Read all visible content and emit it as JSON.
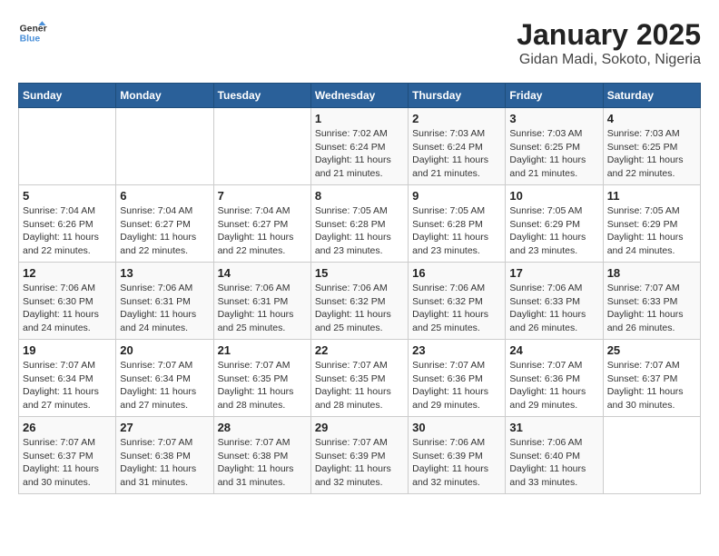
{
  "header": {
    "logo_line1": "General",
    "logo_line2": "Blue",
    "title": "January 2025",
    "subtitle": "Gidan Madi, Sokoto, Nigeria"
  },
  "weekdays": [
    "Sunday",
    "Monday",
    "Tuesday",
    "Wednesday",
    "Thursday",
    "Friday",
    "Saturday"
  ],
  "weeks": [
    [
      {
        "day": "",
        "info": ""
      },
      {
        "day": "",
        "info": ""
      },
      {
        "day": "",
        "info": ""
      },
      {
        "day": "1",
        "info": "Sunrise: 7:02 AM\nSunset: 6:24 PM\nDaylight: 11 hours and 21 minutes."
      },
      {
        "day": "2",
        "info": "Sunrise: 7:03 AM\nSunset: 6:24 PM\nDaylight: 11 hours and 21 minutes."
      },
      {
        "day": "3",
        "info": "Sunrise: 7:03 AM\nSunset: 6:25 PM\nDaylight: 11 hours and 21 minutes."
      },
      {
        "day": "4",
        "info": "Sunrise: 7:03 AM\nSunset: 6:25 PM\nDaylight: 11 hours and 22 minutes."
      }
    ],
    [
      {
        "day": "5",
        "info": "Sunrise: 7:04 AM\nSunset: 6:26 PM\nDaylight: 11 hours and 22 minutes."
      },
      {
        "day": "6",
        "info": "Sunrise: 7:04 AM\nSunset: 6:27 PM\nDaylight: 11 hours and 22 minutes."
      },
      {
        "day": "7",
        "info": "Sunrise: 7:04 AM\nSunset: 6:27 PM\nDaylight: 11 hours and 22 minutes."
      },
      {
        "day": "8",
        "info": "Sunrise: 7:05 AM\nSunset: 6:28 PM\nDaylight: 11 hours and 23 minutes."
      },
      {
        "day": "9",
        "info": "Sunrise: 7:05 AM\nSunset: 6:28 PM\nDaylight: 11 hours and 23 minutes."
      },
      {
        "day": "10",
        "info": "Sunrise: 7:05 AM\nSunset: 6:29 PM\nDaylight: 11 hours and 23 minutes."
      },
      {
        "day": "11",
        "info": "Sunrise: 7:05 AM\nSunset: 6:29 PM\nDaylight: 11 hours and 24 minutes."
      }
    ],
    [
      {
        "day": "12",
        "info": "Sunrise: 7:06 AM\nSunset: 6:30 PM\nDaylight: 11 hours and 24 minutes."
      },
      {
        "day": "13",
        "info": "Sunrise: 7:06 AM\nSunset: 6:31 PM\nDaylight: 11 hours and 24 minutes."
      },
      {
        "day": "14",
        "info": "Sunrise: 7:06 AM\nSunset: 6:31 PM\nDaylight: 11 hours and 25 minutes."
      },
      {
        "day": "15",
        "info": "Sunrise: 7:06 AM\nSunset: 6:32 PM\nDaylight: 11 hours and 25 minutes."
      },
      {
        "day": "16",
        "info": "Sunrise: 7:06 AM\nSunset: 6:32 PM\nDaylight: 11 hours and 25 minutes."
      },
      {
        "day": "17",
        "info": "Sunrise: 7:06 AM\nSunset: 6:33 PM\nDaylight: 11 hours and 26 minutes."
      },
      {
        "day": "18",
        "info": "Sunrise: 7:07 AM\nSunset: 6:33 PM\nDaylight: 11 hours and 26 minutes."
      }
    ],
    [
      {
        "day": "19",
        "info": "Sunrise: 7:07 AM\nSunset: 6:34 PM\nDaylight: 11 hours and 27 minutes."
      },
      {
        "day": "20",
        "info": "Sunrise: 7:07 AM\nSunset: 6:34 PM\nDaylight: 11 hours and 27 minutes."
      },
      {
        "day": "21",
        "info": "Sunrise: 7:07 AM\nSunset: 6:35 PM\nDaylight: 11 hours and 28 minutes."
      },
      {
        "day": "22",
        "info": "Sunrise: 7:07 AM\nSunset: 6:35 PM\nDaylight: 11 hours and 28 minutes."
      },
      {
        "day": "23",
        "info": "Sunrise: 7:07 AM\nSunset: 6:36 PM\nDaylight: 11 hours and 29 minutes."
      },
      {
        "day": "24",
        "info": "Sunrise: 7:07 AM\nSunset: 6:36 PM\nDaylight: 11 hours and 29 minutes."
      },
      {
        "day": "25",
        "info": "Sunrise: 7:07 AM\nSunset: 6:37 PM\nDaylight: 11 hours and 30 minutes."
      }
    ],
    [
      {
        "day": "26",
        "info": "Sunrise: 7:07 AM\nSunset: 6:37 PM\nDaylight: 11 hours and 30 minutes."
      },
      {
        "day": "27",
        "info": "Sunrise: 7:07 AM\nSunset: 6:38 PM\nDaylight: 11 hours and 31 minutes."
      },
      {
        "day": "28",
        "info": "Sunrise: 7:07 AM\nSunset: 6:38 PM\nDaylight: 11 hours and 31 minutes."
      },
      {
        "day": "29",
        "info": "Sunrise: 7:07 AM\nSunset: 6:39 PM\nDaylight: 11 hours and 32 minutes."
      },
      {
        "day": "30",
        "info": "Sunrise: 7:06 AM\nSunset: 6:39 PM\nDaylight: 11 hours and 32 minutes."
      },
      {
        "day": "31",
        "info": "Sunrise: 7:06 AM\nSunset: 6:40 PM\nDaylight: 11 hours and 33 minutes."
      },
      {
        "day": "",
        "info": ""
      }
    ]
  ]
}
